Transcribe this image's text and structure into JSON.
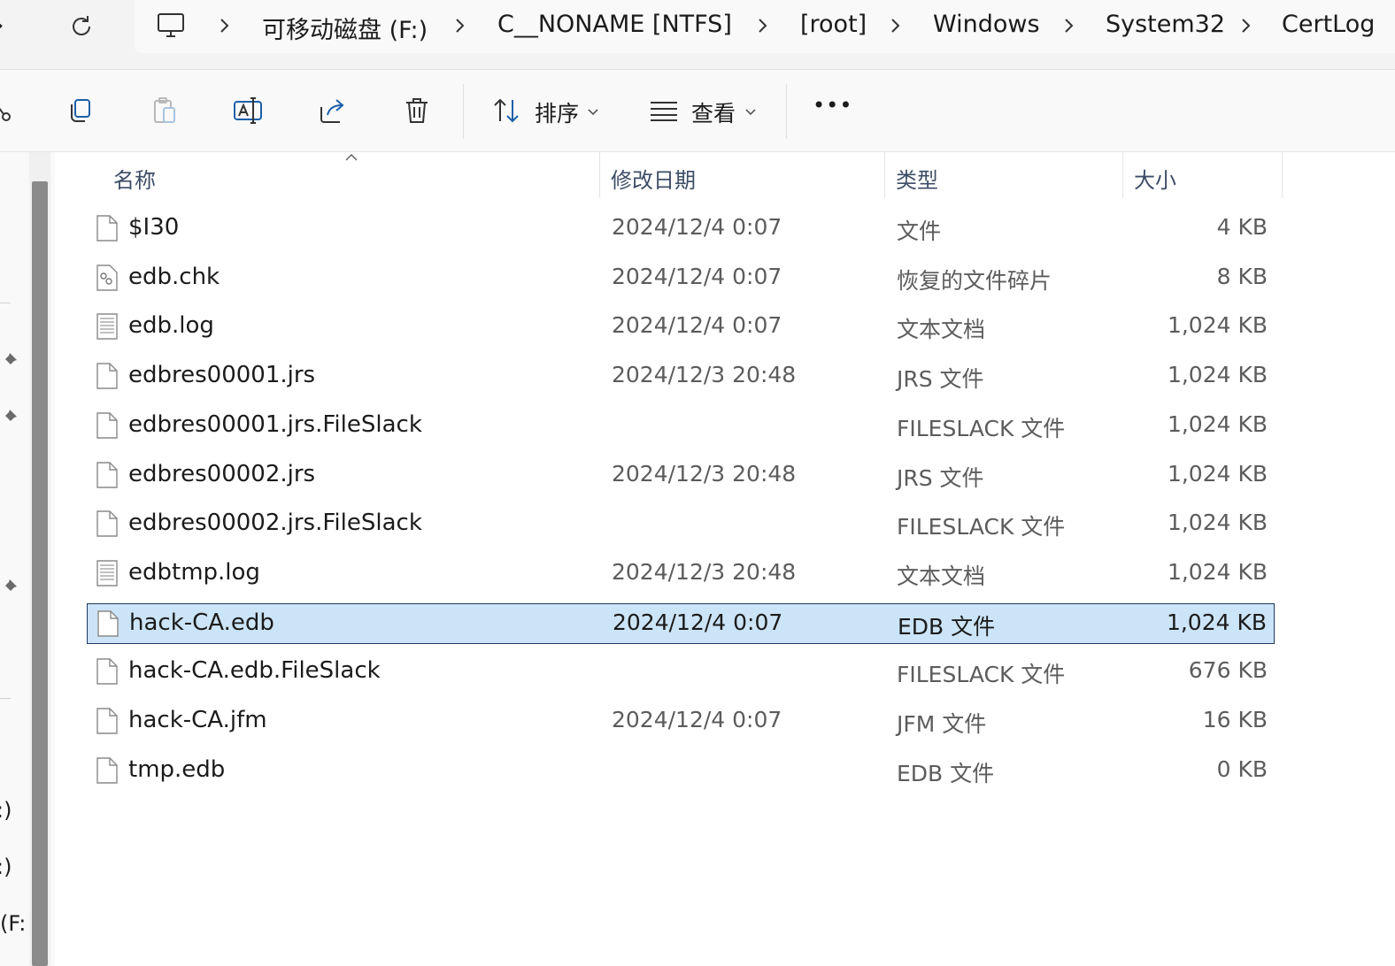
{
  "address": {
    "crumbs": [
      "可移动磁盘 (F:)",
      "C__NONAME [NTFS]",
      "[root]",
      "Windows",
      "System32",
      "CertLog"
    ]
  },
  "toolbar": {
    "sort_label": "排序",
    "view_label": "查看",
    "more_label": "•••"
  },
  "nav": {
    "drives": [
      ":)",
      ":)",
      "(F:"
    ]
  },
  "columns": {
    "name": "名称",
    "date": "修改日期",
    "type": "类型",
    "size": "大小"
  },
  "files": [
    {
      "name": "$I30",
      "date": "2024/12/4 0:07",
      "type": "文件",
      "size": "4 KB",
      "icon": "blank-file-icon"
    },
    {
      "name": "edb.chk",
      "date": "2024/12/4 0:07",
      "type": "恢复的文件碎片",
      "size": "8 KB",
      "icon": "system-file-icon"
    },
    {
      "name": "edb.log",
      "date": "2024/12/4 0:07",
      "type": "文本文档",
      "size": "1,024 KB",
      "icon": "text-file-icon"
    },
    {
      "name": "edbres00001.jrs",
      "date": "2024/12/3 20:48",
      "type": "JRS 文件",
      "size": "1,024 KB",
      "icon": "blank-file-icon"
    },
    {
      "name": "edbres00001.jrs.FileSlack",
      "date": "",
      "type": "FILESLACK 文件",
      "size": "1,024 KB",
      "icon": "blank-file-icon"
    },
    {
      "name": "edbres00002.jrs",
      "date": "2024/12/3 20:48",
      "type": "JRS 文件",
      "size": "1,024 KB",
      "icon": "blank-file-icon"
    },
    {
      "name": "edbres00002.jrs.FileSlack",
      "date": "",
      "type": "FILESLACK 文件",
      "size": "1,024 KB",
      "icon": "blank-file-icon"
    },
    {
      "name": "edbtmp.log",
      "date": "2024/12/3 20:48",
      "type": "文本文档",
      "size": "1,024 KB",
      "icon": "text-file-icon"
    },
    {
      "name": "hack-CA.edb",
      "date": "2024/12/4 0:07",
      "type": "EDB 文件",
      "size": "1,024 KB",
      "icon": "blank-file-icon",
      "selected": true
    },
    {
      "name": "hack-CA.edb.FileSlack",
      "date": "",
      "type": "FILESLACK 文件",
      "size": "676 KB",
      "icon": "blank-file-icon"
    },
    {
      "name": "hack-CA.jfm",
      "date": "2024/12/4 0:07",
      "type": "JFM 文件",
      "size": "16 KB",
      "icon": "blank-file-icon"
    },
    {
      "name": "tmp.edb",
      "date": "",
      "type": "EDB 文件",
      "size": "0 KB",
      "icon": "blank-file-icon"
    }
  ],
  "colors": {
    "selection_bg": "#cce4f7",
    "selection_border": "#1e3a5f",
    "header_text": "#3d4d66"
  }
}
